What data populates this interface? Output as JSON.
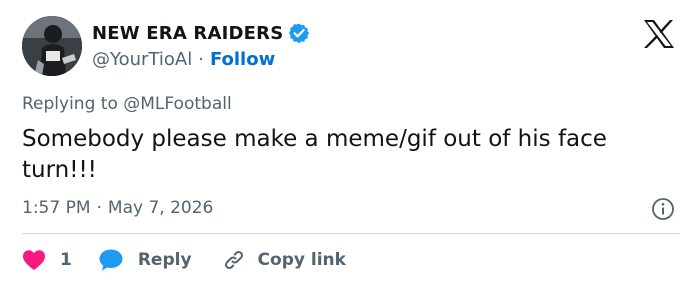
{
  "author": {
    "display_name": "NEW ERA RAIDERS",
    "handle": "@YourTioAl",
    "separator": "·",
    "follow_label": "Follow"
  },
  "reply_context": "Replying to @MLFootball",
  "tweet": {
    "text": "Somebody please make a meme/gif out of his face turn!!!",
    "time": "1:57 PM",
    "separator": "·",
    "date": "May 7, 2026"
  },
  "actions": {
    "like_count": "1",
    "reply_label": "Reply",
    "copy_label": "Copy link"
  },
  "icons": {
    "verified": "verified-badge-icon",
    "brand": "x-logo-icon",
    "info": "info-icon",
    "like": "heart-icon",
    "reply": "speech-bubble-icon",
    "copy": "link-icon"
  },
  "colors": {
    "verified_blue": "#1d9bf0",
    "follow_blue": "#006fd6",
    "like_pink": "#f91880",
    "reply_blue": "#1d9bf0",
    "secondary_text": "#536471",
    "primary_text": "#0f1419"
  }
}
